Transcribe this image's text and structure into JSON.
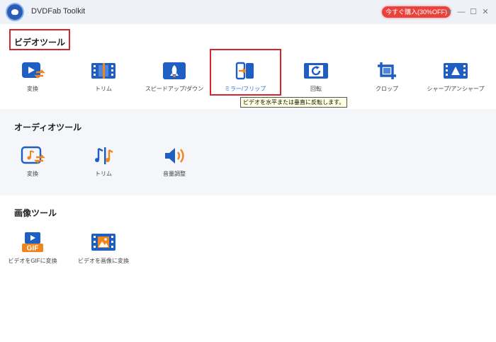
{
  "window": {
    "app_title": "DVDFab Toolkit",
    "promo_label": "今すぐ購入(30%OFF)",
    "controls": {
      "menu": "▾",
      "minimize": "—",
      "maximize": "☐",
      "close": "✕"
    }
  },
  "colors": {
    "accent": "#2f6fd8",
    "icon_blue": "#1f5fc4",
    "icon_orange": "#f0851e",
    "highlight": "#d6262d",
    "promo": "#e8423c"
  },
  "video_tools": {
    "title": "ビデオツール",
    "items": [
      {
        "label": "変換",
        "icon": "video-convert-icon"
      },
      {
        "label": "トリム",
        "icon": "film-strip-icon"
      },
      {
        "label": "スピードアップ/ダウン",
        "icon": "rocket-icon"
      },
      {
        "label": "ミラー/フリップ",
        "icon": "mirror-flip-icon"
      },
      {
        "label": "回転",
        "icon": "rotate-icon"
      },
      {
        "label": "クロップ",
        "icon": "crop-icon"
      },
      {
        "label": "シャープ/アンシャープ",
        "icon": "sharpen-icon"
      }
    ],
    "tooltip": "ビデオを水平または垂直に反転します。"
  },
  "audio_tools": {
    "title": "オーディオツール",
    "items": [
      {
        "label": "変換",
        "icon": "audio-convert-icon"
      },
      {
        "label": "トリム",
        "icon": "audio-trim-icon"
      },
      {
        "label": "音量調整",
        "icon": "speaker-volume-icon"
      }
    ]
  },
  "image_tools": {
    "title": "画像ツール",
    "items": [
      {
        "label": "ビデオをGIFに変換",
        "icon": "video-to-gif-icon",
        "badge": "GIF"
      },
      {
        "label": "ビデオを画像に変換",
        "icon": "video-to-image-icon"
      }
    ]
  }
}
